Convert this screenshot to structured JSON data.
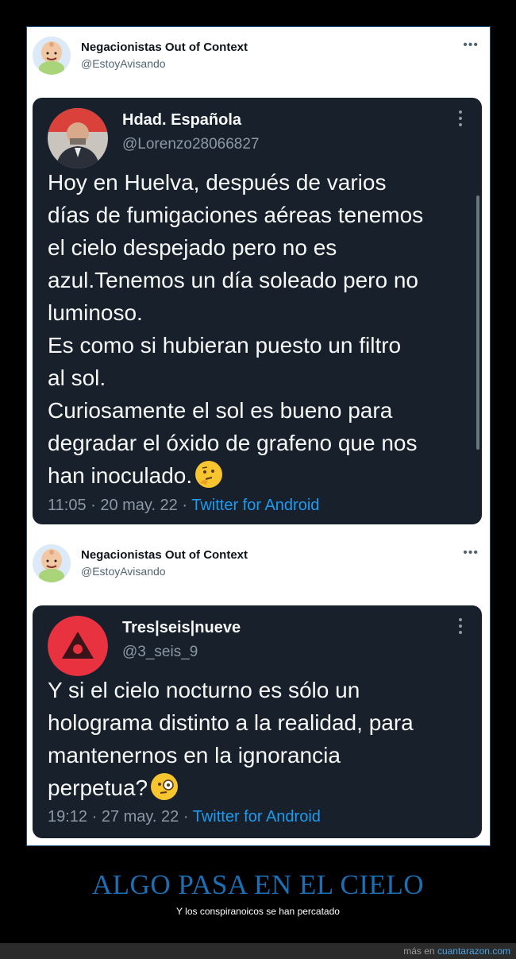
{
  "posts": [
    {
      "author": {
        "name": "Negacionistas Out of Context",
        "handle": "@EstoyAvisando"
      },
      "more_icon": "ellipsis-icon",
      "embedded": {
        "name": "Hdad. Española",
        "handle": "@Lorenzo28066827",
        "text": "Hoy en Huelva, después de varios\ndías de fumigaciones aéreas tenemos\nel cielo despejado pero no es\nazul.Tenemos un día soleado pero no\nluminoso.\nEs como si hubieran puesto un filtro\nal sol.\nCuriosamente el sol es bueno para\ndegradar el óxido de grafeno que nos\nhan inoculado.",
        "emoji": "thinking-face-emoji",
        "time": "11:05 · 20 may. 22 · ",
        "source": "Twitter for Android"
      }
    },
    {
      "author": {
        "name": "Negacionistas Out of Context",
        "handle": "@EstoyAvisando"
      },
      "more_icon": "ellipsis-icon",
      "embedded": {
        "name": "Tres|seis|nueve",
        "handle": "@3_seis_9",
        "text": "Y si el cielo nocturno es sólo un\nholograma distinto a la realidad, para\nmantenernos en la ignorancia\nperpetua?",
        "emoji": "face-with-monocle-emoji",
        "time": "19:12 · 27 may. 22 · ",
        "source": "Twitter for Android"
      }
    }
  ],
  "caption": {
    "title": "ALGO PASA EN EL CIELO",
    "subtitle": "Y los conspiranoicos se han percatado"
  },
  "footer": {
    "prefix": "más en ",
    "site": "cuantarazon.com"
  },
  "colors": {
    "background": "#000000",
    "card_dark": "#17202b",
    "link_blue": "#1d9bf0",
    "caption_blue": "#1b6fb5"
  }
}
